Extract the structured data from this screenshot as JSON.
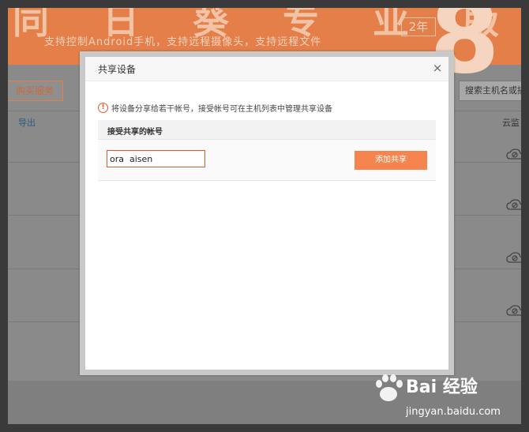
{
  "background_page": {
    "banner": {
      "title": "同 日 葵 专 业 版",
      "subtitle": "支持控制Android手机，支持远程摄像头，支持远程文件",
      "badge": "2年",
      "version_glyph": "8"
    },
    "buy_button_label": "购买服务",
    "export_label": "导出",
    "search_placeholder": "搜索主机名或描",
    "cloud_column_label": "云监"
  },
  "modal": {
    "title": "共享设备",
    "close_glyph": "×",
    "notice": "将设备分享给若干帐号，接受帐号可在主机列表中管理共享设备",
    "table_header": "接受共享的帐号",
    "account_input_value": "ora  aisen",
    "add_button_label": "添加共享"
  },
  "watermark": {
    "brand": "Bai 经验",
    "url": "jingyan.baidu.com"
  },
  "colors": {
    "accent": "#f5844e",
    "banner": "#e47f4a",
    "overlay": "#8a8a8a"
  }
}
